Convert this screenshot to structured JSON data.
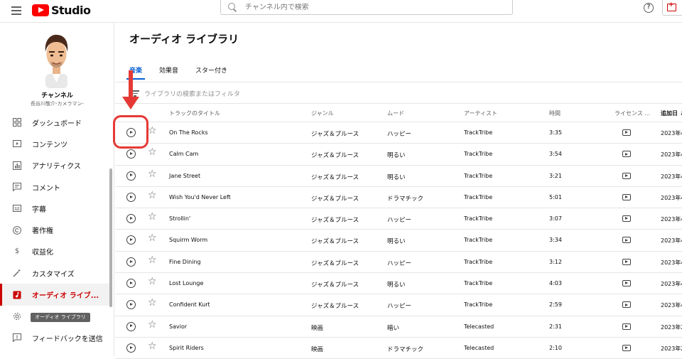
{
  "topbar": {
    "logo_text": "Studio",
    "search_placeholder": "チャンネル内で検索"
  },
  "sidebar": {
    "channel_name": "チャンネル",
    "channel_handle": "長谷川敬介-カメラマン-",
    "items": [
      {
        "label": "ダッシュボード",
        "icon": "dashboard-icon"
      },
      {
        "label": "コンテンツ",
        "icon": "content-icon"
      },
      {
        "label": "アナリティクス",
        "icon": "analytics-icon"
      },
      {
        "label": "コメント",
        "icon": "comments-icon"
      },
      {
        "label": "字幕",
        "icon": "subtitles-icon"
      },
      {
        "label": "著作権",
        "icon": "copyright-icon"
      },
      {
        "label": "収益化",
        "icon": "monetization-icon"
      },
      {
        "label": "カスタマイズ",
        "icon": "customize-icon"
      },
      {
        "label": "オーディオ ライブ...",
        "icon": "audio-library-icon"
      },
      {
        "label": "",
        "icon": "settings-icon"
      },
      {
        "label": "フィードバックを送信",
        "icon": "feedback-icon"
      }
    ],
    "tooltip": "オーディオ ライブラリ"
  },
  "main": {
    "title": "オーディオ ライブラリ",
    "tabs": [
      "音楽",
      "効果音",
      "スター付き"
    ],
    "filter_placeholder": "ライブラリの検索またはフィルタ",
    "columns": {
      "title": "トラックのタイトル",
      "genre": "ジャンル",
      "mood": "ムード",
      "artist": "アーティスト",
      "time": "時間",
      "license": "ライセンス ...",
      "added": "追加日 ↓"
    },
    "rows": [
      {
        "title": "On The Rocks",
        "genre": "ジャズ＆ブルース",
        "mood": "ハッピー",
        "artist": "TrackTribe",
        "time": "3:35",
        "added": "2023年4"
      },
      {
        "title": "Calm Cam",
        "genre": "ジャズ＆ブルース",
        "mood": "明るい",
        "artist": "TrackTribe",
        "time": "3:54",
        "added": "2023年4"
      },
      {
        "title": "Jane Street",
        "genre": "ジャズ＆ブルース",
        "mood": "明るい",
        "artist": "TrackTribe",
        "time": "3:21",
        "added": "2023年4"
      },
      {
        "title": "Wish You'd Never Left",
        "genre": "ジャズ＆ブルース",
        "mood": "ドラマチック",
        "artist": "TrackTribe",
        "time": "5:01",
        "added": "2023年4"
      },
      {
        "title": "Strollin'",
        "genre": "ジャズ＆ブルース",
        "mood": "ハッピー",
        "artist": "TrackTribe",
        "time": "3:07",
        "added": "2023年4"
      },
      {
        "title": "Squirm Worm",
        "genre": "ジャズ＆ブルース",
        "mood": "明るい",
        "artist": "TrackTribe",
        "time": "3:34",
        "added": "2023年4"
      },
      {
        "title": "Fine Dining",
        "genre": "ジャズ＆ブルース",
        "mood": "ハッピー",
        "artist": "TrackTribe",
        "time": "3:12",
        "added": "2023年4"
      },
      {
        "title": "Lost Lounge",
        "genre": "ジャズ＆ブルース",
        "mood": "明るい",
        "artist": "TrackTribe",
        "time": "4:03",
        "added": "2023年4"
      },
      {
        "title": "Confident Kurt",
        "genre": "ジャズ＆ブルース",
        "mood": "ハッピー",
        "artist": "TrackTribe",
        "time": "2:59",
        "added": "2023年4"
      },
      {
        "title": "Savior",
        "genre": "映画",
        "mood": "暗い",
        "artist": "Telecasted",
        "time": "2:31",
        "added": "2023年2"
      },
      {
        "title": "Spirit Riders",
        "genre": "映画",
        "mood": "ドラマチック",
        "artist": "Telecasted",
        "time": "2:10",
        "added": "2023年2"
      }
    ]
  },
  "colors": {
    "accent_red": "#cc0000",
    "annotation_red": "#e53935",
    "tab_blue": "#065fd4"
  }
}
